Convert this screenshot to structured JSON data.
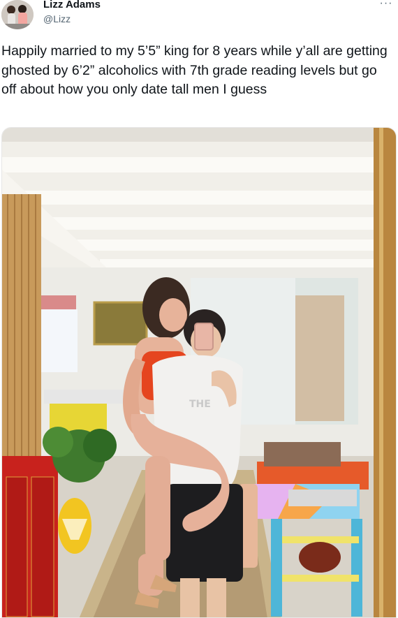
{
  "tweet": {
    "author": {
      "display_name": "Lizz Adams",
      "handle": "@Lizz"
    },
    "more_label": "···",
    "text": "Happily married to my 5’5” king for 8 years while y’all are getting ghosted by 6’2” alcoholics with 7th grade reading levels but go off about how you only date tall men I guess",
    "media": {
      "kind": "photo",
      "shirt_text": "THE"
    }
  },
  "colors": {
    "text_primary": "#0f1419",
    "text_secondary": "#536471",
    "cabinet_red": "#c8221d",
    "mirror_frame": "#b9863f"
  },
  "icons": {
    "more": "more-horizontal-icon"
  }
}
